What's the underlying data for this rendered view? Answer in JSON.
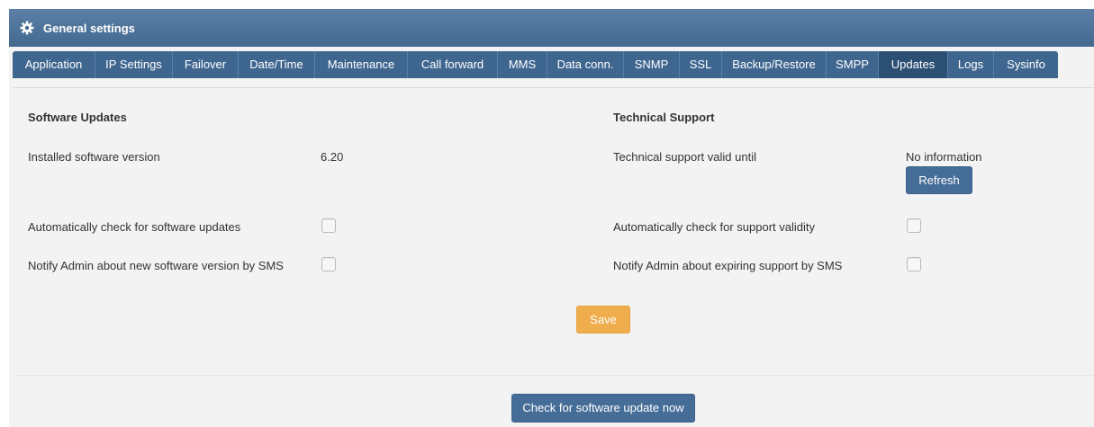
{
  "header": {
    "title": "General settings",
    "icon": "gear-icon"
  },
  "tabs": [
    {
      "label": "Application"
    },
    {
      "label": "IP Settings"
    },
    {
      "label": "Failover"
    },
    {
      "label": "Date/Time"
    },
    {
      "label": "Maintenance"
    },
    {
      "label": "Call forward"
    },
    {
      "label": "MMS"
    },
    {
      "label": "Data conn."
    },
    {
      "label": "SNMP"
    },
    {
      "label": "SSL"
    },
    {
      "label": "Backup/Restore"
    },
    {
      "label": "SMPP"
    },
    {
      "label": "Updates"
    },
    {
      "label": "Logs"
    },
    {
      "label": "Sysinfo"
    }
  ],
  "active_tab": "Updates",
  "software": {
    "heading": "Software Updates",
    "installed_label": "Installed software version",
    "installed_value": "6.20",
    "auto_check_label": "Automatically check for software updates",
    "notify_label": "Notify Admin about new software version by SMS"
  },
  "support": {
    "heading": "Technical Support",
    "valid_until_label": "Technical support valid until",
    "valid_until_value": "No information",
    "refresh_label": "Refresh",
    "auto_check_label": "Automatically check for support validity",
    "notify_label": "Notify Admin about expiring support by SMS"
  },
  "actions": {
    "save_label": "Save",
    "check_now_label": "Check for software update now"
  },
  "colors": {
    "header": "#44698f",
    "tab_bar": "#3f668f",
    "tab_active": "#2c4f74",
    "button_primary": "#456d97",
    "button_save": "#efad4d"
  }
}
